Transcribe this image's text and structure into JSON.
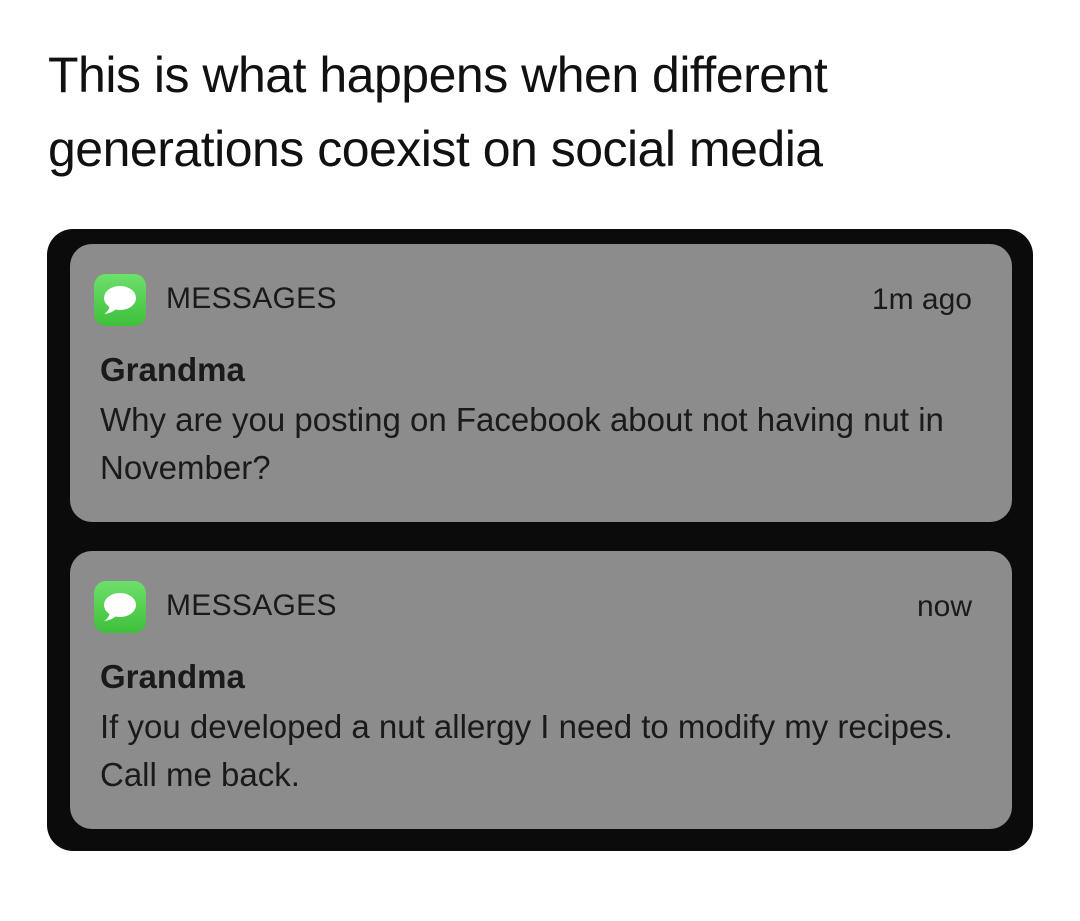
{
  "caption": {
    "line1": "This is what happens when different",
    "line2": "generations coexist on social media"
  },
  "notifications": [
    {
      "app_name": "MESSAGES",
      "app_icon": "messages-bubble-icon",
      "time": "1m ago",
      "sender": "Grandma",
      "body": "Why are you posting on Facebook about not having nut in November?"
    },
    {
      "app_name": "MESSAGES",
      "app_icon": "messages-bubble-icon",
      "time": "now",
      "sender": "Grandma",
      "body": "If you developed a nut allergy I need to modify my recipes. Call me back."
    }
  ],
  "colors": {
    "frame": "#0b0b0b",
    "card": "#8c8c8c",
    "icon_green": "#4cd448",
    "text": "#1a1a1a"
  }
}
